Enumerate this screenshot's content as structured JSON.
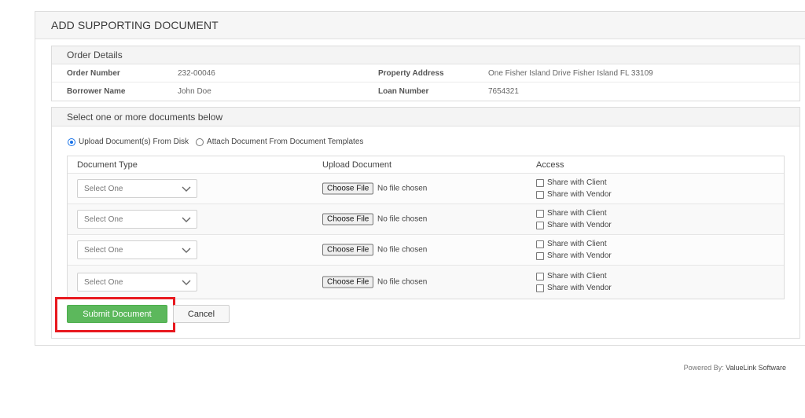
{
  "panel": {
    "title": "ADD SUPPORTING DOCUMENT"
  },
  "order_details": {
    "title": "Order Details",
    "rows": [
      {
        "label1": "Order Number",
        "value1": "232-00046",
        "label2": "Property Address",
        "value2": "One Fisher Island Drive Fisher Island FL 33109"
      },
      {
        "label1": "Borrower Name",
        "value1": "John Doe",
        "label2": "Loan Number",
        "value2": "7654321"
      }
    ]
  },
  "documents": {
    "title": "Select one or more documents below",
    "radio_upload": "Upload Document(s) From Disk",
    "radio_template": "Attach Document From Document Templates",
    "selected_option": "upload",
    "headers": {
      "type": "Document Type",
      "upload": "Upload Document",
      "access": "Access"
    },
    "rows": [
      {
        "select": "Select One",
        "file_button": "Choose File",
        "file_status": "No file chosen",
        "client": "Share with Client",
        "vendor": "Share with Vendor",
        "client_checked": false,
        "vendor_checked": false
      },
      {
        "select": "Select One",
        "file_button": "Choose File",
        "file_status": "No file chosen",
        "client": "Share with Client",
        "vendor": "Share with Vendor",
        "client_checked": false,
        "vendor_checked": false
      },
      {
        "select": "Select One",
        "file_button": "Choose File",
        "file_status": "No file chosen",
        "client": "Share with Client",
        "vendor": "Share with Vendor",
        "client_checked": false,
        "vendor_checked": false
      },
      {
        "select": "Select One",
        "file_button": "Choose File",
        "file_status": "No file chosen",
        "client": "Share with Client",
        "vendor": "Share with Vendor",
        "client_checked": false,
        "vendor_checked": false
      }
    ]
  },
  "actions": {
    "submit": "Submit Document",
    "cancel": "Cancel"
  },
  "footer": {
    "prefix": "Powered By:",
    "brand": "ValueLink Software"
  },
  "colors": {
    "submit_green": "#5cb85c",
    "highlight_red": "#e8191f",
    "radio_blue": "#1a73e8"
  }
}
